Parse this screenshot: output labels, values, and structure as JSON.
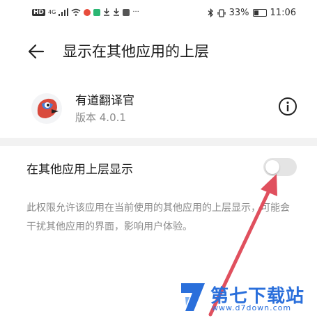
{
  "status_bar": {
    "left_label": "HD",
    "signal_label": "4G",
    "battery_text": "33%",
    "time": "11:06"
  },
  "header": {
    "title": "显示在其他应用的上层",
    "back_icon": "back-arrow-icon"
  },
  "app": {
    "name": "有道翻译官",
    "version": "版本 4.0.1",
    "avatar_icon": "youdao-bird-icon",
    "info_icon": "info-icon"
  },
  "setting": {
    "label": "在其他应用上层显示",
    "enabled": false
  },
  "description": "此权限允许该应用在当前使用的其他应用的上层显示，可能会干扰其他应用的界面，影响用户体验。",
  "watermark": {
    "title": "第七下载站",
    "url": "www.d7down.com"
  },
  "colors": {
    "accent": "#2a6fdb",
    "arrow": "#e0505e",
    "toggle_off": "#e4e4e4"
  }
}
